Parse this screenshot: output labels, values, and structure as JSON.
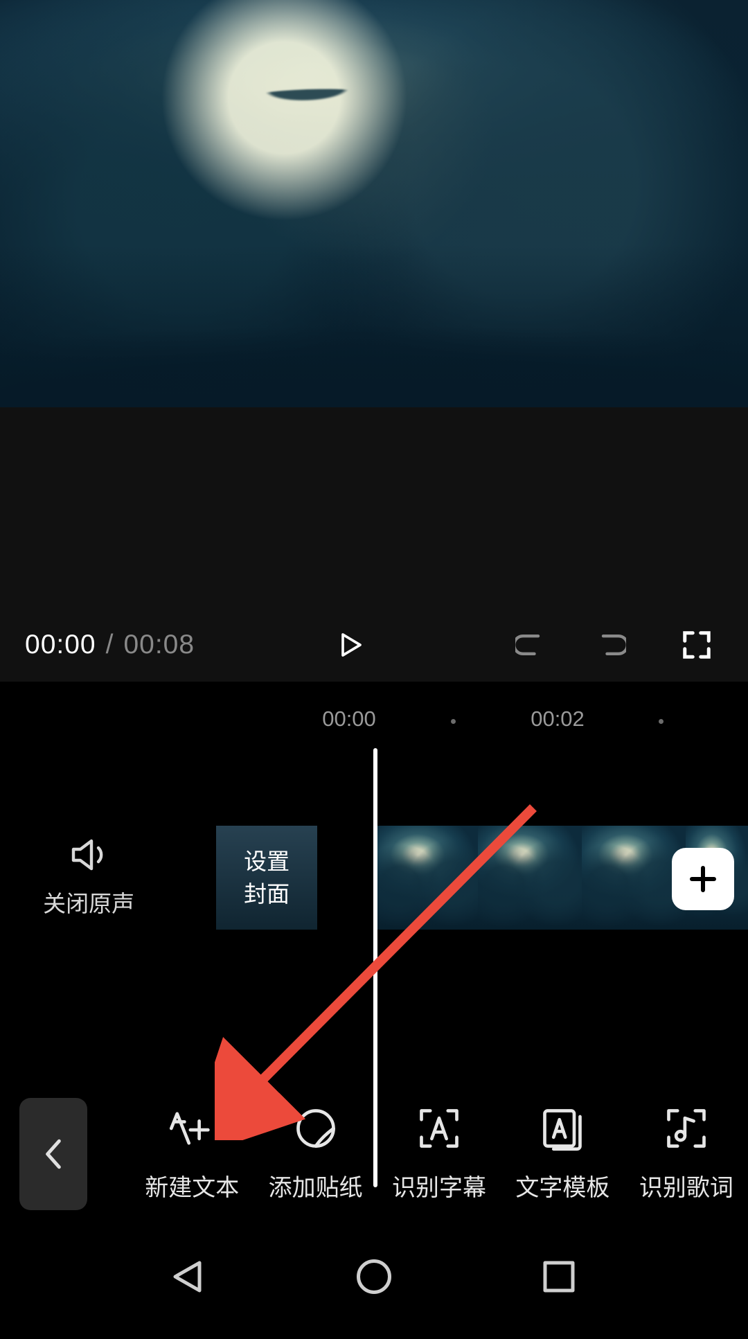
{
  "playback": {
    "current_time": "00:00",
    "separator": "/",
    "duration": "00:08"
  },
  "ruler": {
    "mark_0": "00:00",
    "mark_1": "00:02"
  },
  "timeline": {
    "mute_label": "关闭原声",
    "cover_line1": "设置",
    "cover_line2": "封面"
  },
  "toolbar": {
    "new_text": "新建文本",
    "add_sticker": "添加贴纸",
    "recognize_subtitle": "识别字幕",
    "text_template": "文字模板",
    "recognize_lyrics": "识别歌词"
  }
}
